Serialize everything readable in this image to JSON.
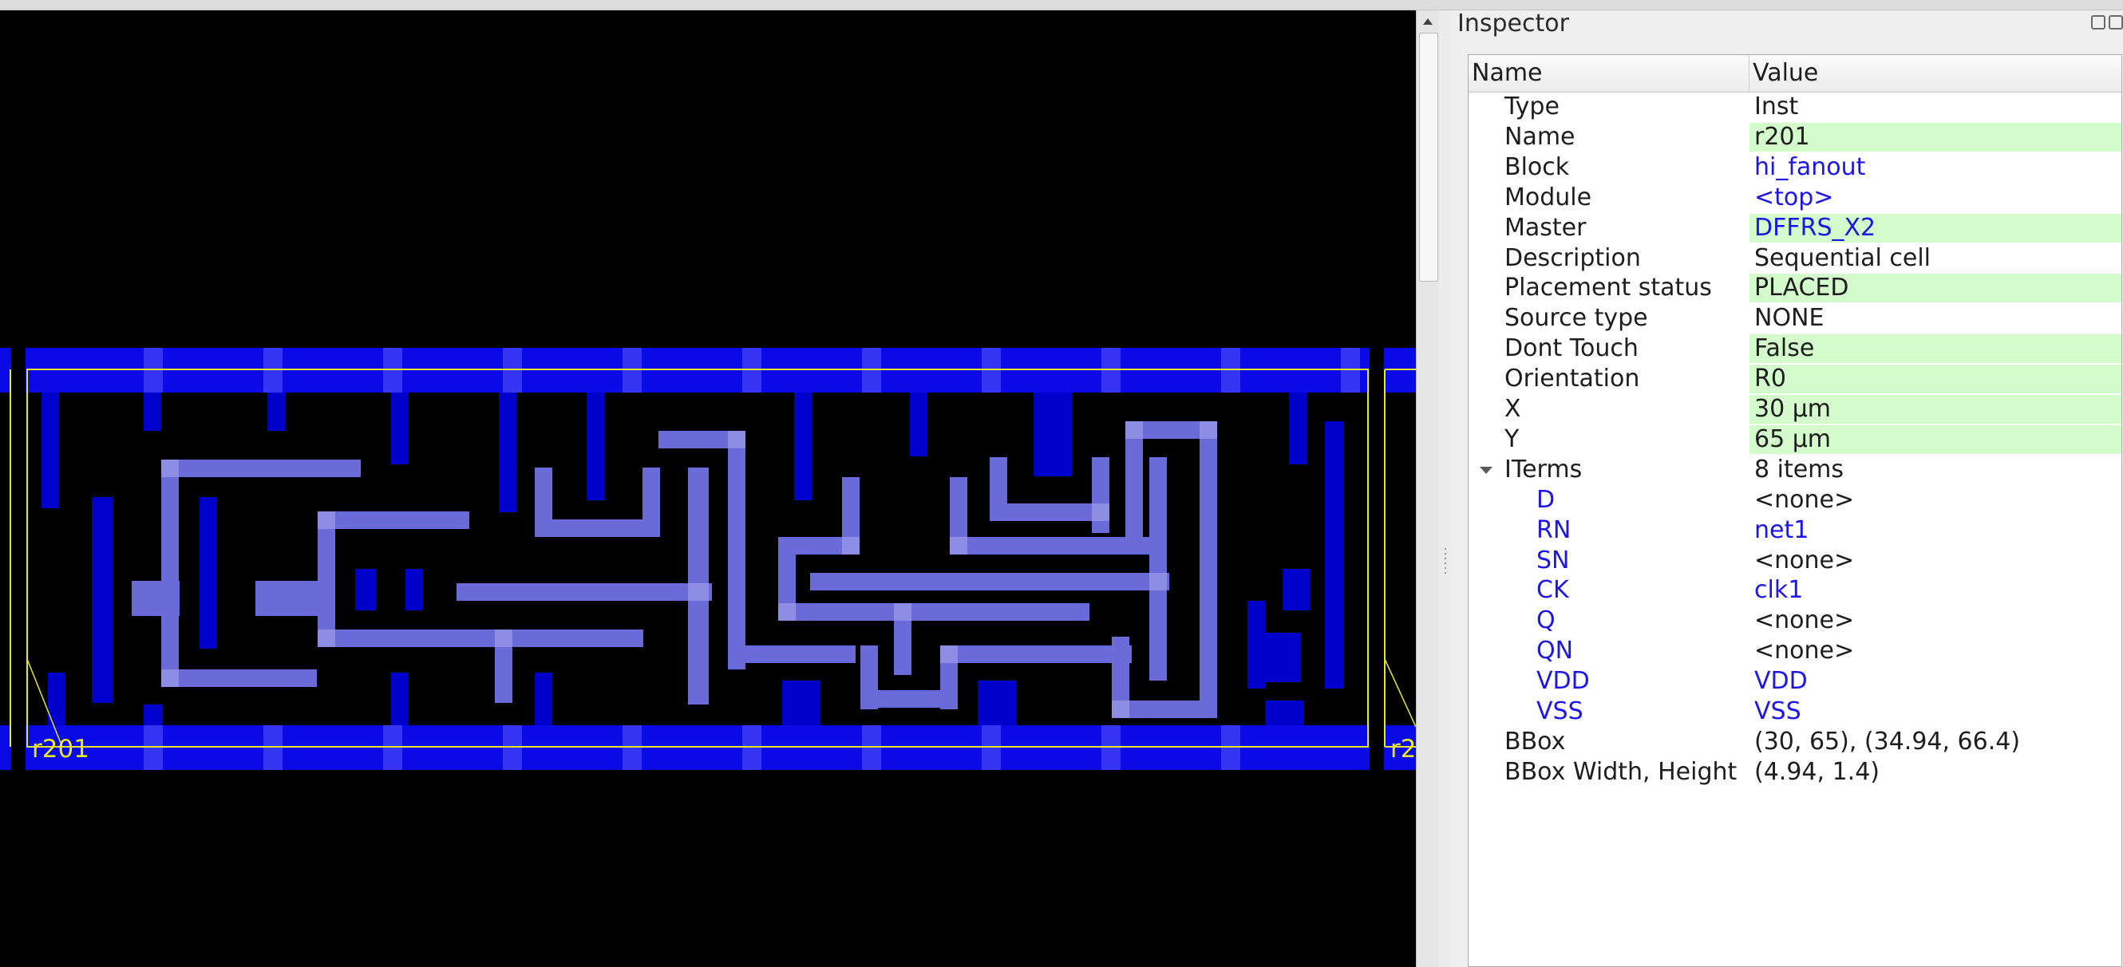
{
  "inspector": {
    "title": "Inspector",
    "columns": {
      "name": "Name",
      "value": "Value"
    },
    "rows": [
      {
        "name": "Type",
        "value": "Inst",
        "highlight": false,
        "link": false,
        "level": 0
      },
      {
        "name": "Name",
        "value": "r201",
        "highlight": true,
        "link": false,
        "level": 0
      },
      {
        "name": "Block",
        "value": "hi_fanout",
        "highlight": false,
        "link": true,
        "level": 0
      },
      {
        "name": "Module",
        "value": "<top>",
        "highlight": false,
        "link": true,
        "level": 0
      },
      {
        "name": "Master",
        "value": "DFFRS_X2",
        "highlight": true,
        "link": true,
        "level": 0
      },
      {
        "name": "Description",
        "value": "Sequential cell",
        "highlight": false,
        "link": false,
        "level": 0
      },
      {
        "name": "Placement status",
        "value": "PLACED",
        "highlight": true,
        "link": false,
        "level": 0
      },
      {
        "name": "Source type",
        "value": "NONE",
        "highlight": false,
        "link": false,
        "level": 0
      },
      {
        "name": "Dont Touch",
        "value": "False",
        "highlight": true,
        "link": false,
        "level": 0
      },
      {
        "name": "Orientation",
        "value": "R0",
        "highlight": true,
        "link": false,
        "level": 0
      },
      {
        "name": "X",
        "value": "30 µm",
        "highlight": true,
        "link": false,
        "level": 0
      },
      {
        "name": "Y",
        "value": "65 µm",
        "highlight": true,
        "link": false,
        "level": 0
      },
      {
        "name": "ITerms",
        "value": "8 items",
        "highlight": false,
        "link": false,
        "level": 0,
        "expanded": true
      },
      {
        "name": "D",
        "value": "<none>",
        "highlight": false,
        "link": false,
        "level": 1
      },
      {
        "name": "RN",
        "value": "net1",
        "highlight": false,
        "link": true,
        "level": 1
      },
      {
        "name": "SN",
        "value": "<none>",
        "highlight": false,
        "link": false,
        "level": 1
      },
      {
        "name": "CK",
        "value": "clk1",
        "highlight": false,
        "link": true,
        "level": 1
      },
      {
        "name": "Q",
        "value": "<none>",
        "highlight": false,
        "link": false,
        "level": 1
      },
      {
        "name": "QN",
        "value": "<none>",
        "highlight": false,
        "link": false,
        "level": 1
      },
      {
        "name": "VDD",
        "value": "VDD",
        "highlight": false,
        "link": true,
        "level": 1
      },
      {
        "name": "VSS",
        "value": "VSS",
        "highlight": false,
        "link": true,
        "level": 1
      },
      {
        "name": "BBox",
        "value": "(30, 65), (34.94, 66.4)",
        "highlight": false,
        "link": false,
        "level": 0
      },
      {
        "name": "BBox Width, Height",
        "value": "(4.94, 1.4)",
        "highlight": false,
        "link": false,
        "level": 0
      }
    ]
  },
  "layout": {
    "instance_label": "r201",
    "neighbor_label": "r2",
    "colors": {
      "background": "#000000",
      "rail": "#0a0ae6",
      "metal1": "#0000cc",
      "poly": "#6a6ad8",
      "highlight": "#d3fbcb",
      "link": "#1c16e6",
      "bbox_outline": "#e6e62a"
    }
  }
}
